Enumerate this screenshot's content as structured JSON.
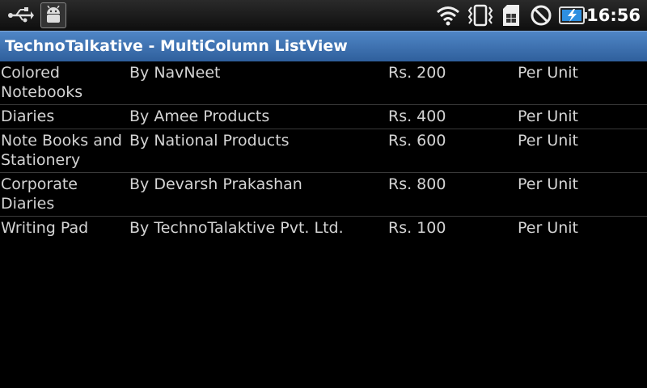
{
  "status_bar": {
    "icons": [
      "usb-icon",
      "android-debug-icon",
      "wifi-icon",
      "vibrate-icon",
      "sim-card-icon",
      "no-signal-icon",
      "battery-charging-icon"
    ],
    "time": "16:56"
  },
  "title_bar": {
    "title": "TechnoTalkative - MultiColumn ListView"
  },
  "list": {
    "rows": [
      {
        "name": "Colored Notebooks",
        "by": "By NavNeet",
        "price": "Rs. 200",
        "unit": "Per Unit"
      },
      {
        "name": "Diaries",
        "by": "By Amee Products",
        "price": "Rs. 400",
        "unit": "Per Unit"
      },
      {
        "name": "Note Books and Stationery",
        "by": "By National Products",
        "price": "Rs. 600",
        "unit": "Per Unit"
      },
      {
        "name": "Corporate Diaries",
        "by": "By Devarsh Prakashan",
        "price": "Rs. 800",
        "unit": "Per Unit"
      },
      {
        "name": "Writing Pad",
        "by": "By TechnoTalaktive Pvt. Ltd.",
        "price": "Rs. 100",
        "unit": "Per Unit"
      }
    ]
  }
}
